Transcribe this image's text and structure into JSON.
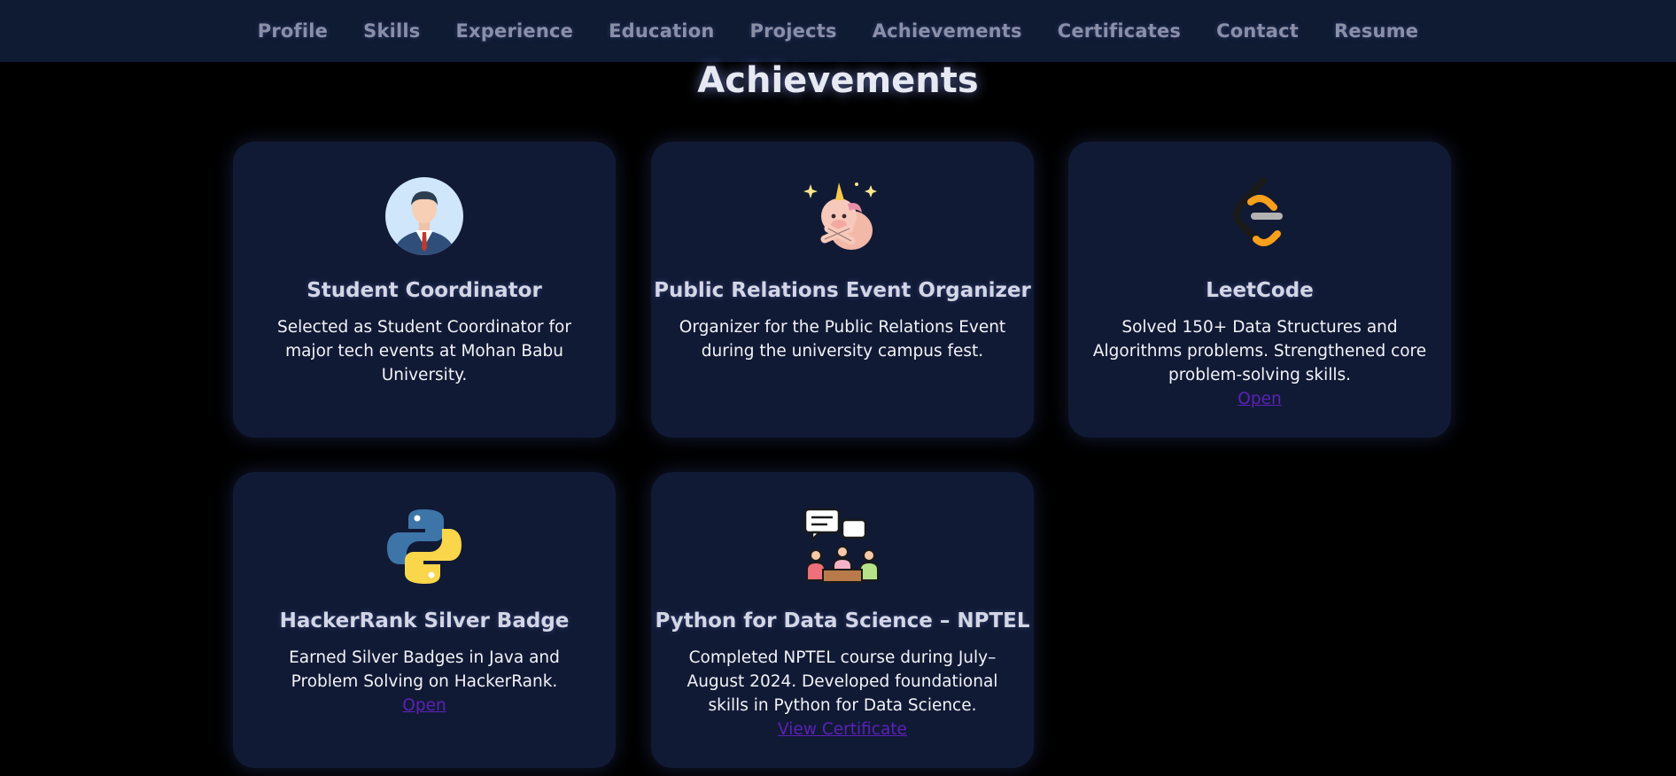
{
  "nav": {
    "items": [
      {
        "label": "Profile"
      },
      {
        "label": "Skills"
      },
      {
        "label": "Experience"
      },
      {
        "label": "Education"
      },
      {
        "label": "Projects"
      },
      {
        "label": "Achievements"
      },
      {
        "label": "Certificates"
      },
      {
        "label": "Contact"
      },
      {
        "label": "Resume"
      }
    ]
  },
  "section": {
    "title": "Achievements"
  },
  "cards": [
    {
      "icon": "businessman-avatar-icon",
      "title": "Student Coordinator",
      "description": "Selected as Student Coordinator for major tech events at Mohan Babu University."
    },
    {
      "icon": "unicorn-icon",
      "title": "Public Relations Event Organizer",
      "description": "Organizer for the Public Relations Event during the university campus fest."
    },
    {
      "icon": "leetcode-logo-icon",
      "title": "LeetCode",
      "description": "Solved 150+ Data Structures and Algorithms problems. Strengthened core problem-solving skills.",
      "link_label": "Open"
    },
    {
      "icon": "python-logo-icon",
      "title": "HackerRank Silver Badge",
      "description": "Earned Silver Badges in Java and Problem Solving on HackerRank.",
      "link_label": "Open"
    },
    {
      "icon": "team-discussion-icon",
      "title": "Python for Data Science – NPTEL",
      "description": "Completed NPTEL course during July–August 2024. Developed foundational skills in Python for Data Science.",
      "link_label": "View Certificate"
    }
  ],
  "colors": {
    "background": "#000000",
    "navbar": "#0f1a33",
    "card": "#111a35",
    "link": "#5b21b6",
    "nav_text": "#8a8fa8"
  }
}
